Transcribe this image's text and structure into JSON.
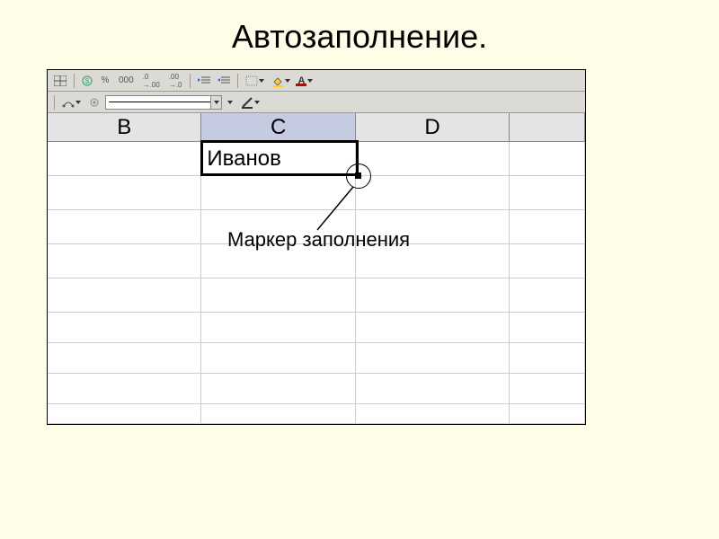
{
  "slide": {
    "title": "Автозаполнение."
  },
  "toolbar": {
    "percent": "%",
    "thousands": "000",
    "dec_add": ".0",
    "dec_remove": ".00",
    "font_letter": "A"
  },
  "columns": {
    "B": "B",
    "C": "C",
    "D": "D"
  },
  "cells": {
    "C1": "Иванов"
  },
  "annotation": {
    "label": "Маркер заполнения"
  }
}
